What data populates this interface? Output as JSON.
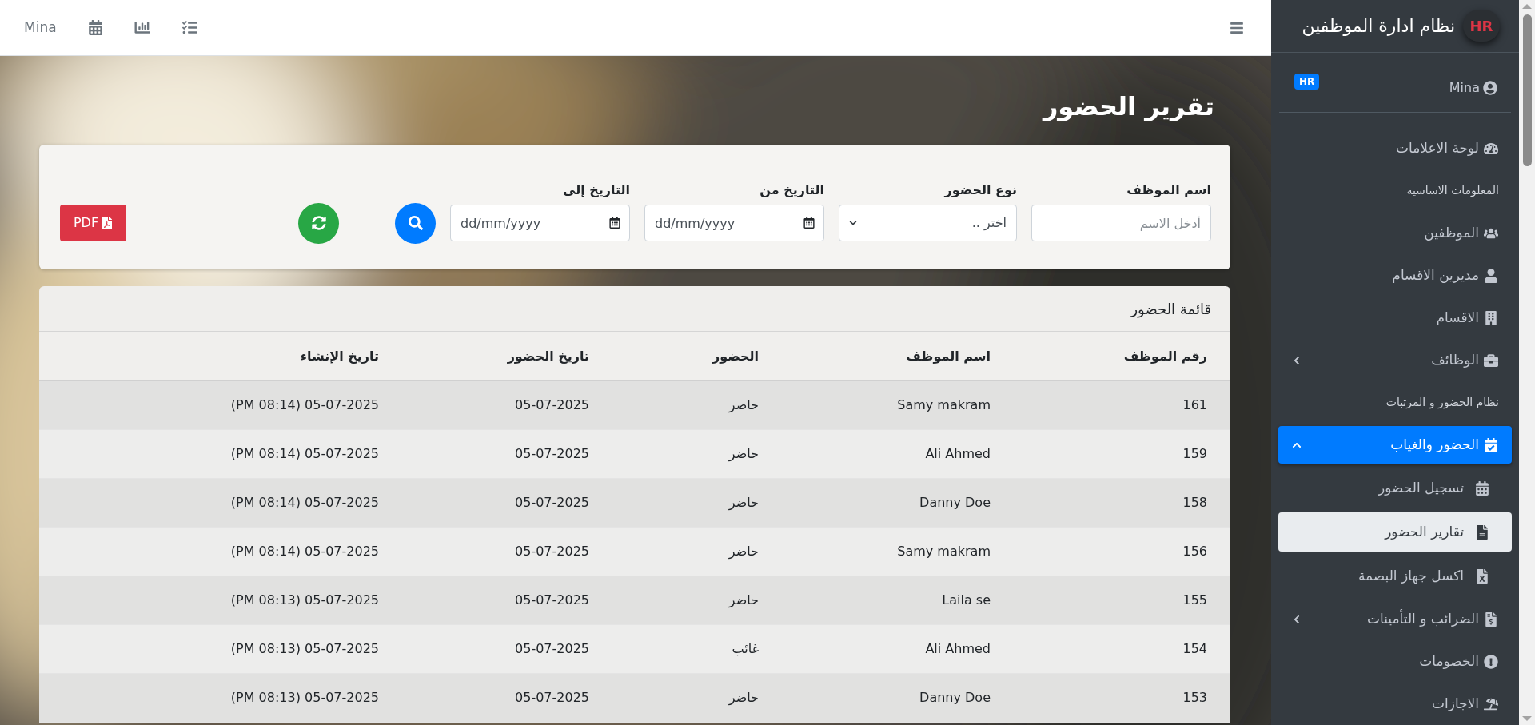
{
  "topbar": {
    "user": "Mina"
  },
  "sidebar": {
    "brand": {
      "logo": "HR",
      "title": "نظام ادارة الموظفين"
    },
    "user": {
      "name": "Mina",
      "badge": "HR"
    },
    "items": [
      {
        "kind": "link",
        "label": "لوحة الاعلامات",
        "selected": false
      },
      {
        "kind": "heading",
        "label": "المعلومات الاساسية"
      },
      {
        "kind": "link",
        "label": "الموظفين",
        "selected": false
      },
      {
        "kind": "link",
        "label": "مديرين الاقسام",
        "selected": false
      },
      {
        "kind": "link",
        "label": "الاقسام",
        "selected": false
      },
      {
        "kind": "link",
        "label": "الوظائف",
        "selected": false,
        "expanded": false
      },
      {
        "kind": "heading",
        "label": "نظام الحضور و المرتبات"
      },
      {
        "kind": "link",
        "label": "الحضور والغياب",
        "selected": true,
        "expanded": true,
        "children": [
          {
            "label": "تسجيل الحضور",
            "selected": false
          },
          {
            "label": "تقارير الحضور",
            "selected": true
          },
          {
            "label": "اكسل جهاز البصمة",
            "selected": false
          }
        ]
      },
      {
        "kind": "link",
        "label": "الضرائب و التأمينات",
        "selected": false,
        "expanded": false
      },
      {
        "kind": "link",
        "label": "الخصومات",
        "selected": false
      },
      {
        "kind": "link",
        "label": "الاجازات",
        "selected": false
      }
    ]
  },
  "page": {
    "title": "تقرير الحضور"
  },
  "filters": {
    "fields": [
      {
        "kind": "text",
        "label": "اسم الموظف",
        "placeholder": "أدخل الاسم"
      },
      {
        "kind": "select",
        "label": "نوع الحضور",
        "value": "اختر .."
      },
      {
        "kind": "date",
        "label": "التاريخ من",
        "placeholder": "dd/mm/yyyy"
      },
      {
        "kind": "date",
        "label": "التاريخ إلى",
        "placeholder": "dd/mm/yyyy"
      }
    ],
    "pdf_button": "PDF"
  },
  "table": {
    "title": "قائمة الحضور",
    "columns": [
      "رقم الموظف",
      "اسم الموظف",
      "الحضور",
      "تاريخ الحضور",
      "تاريخ الإنشاء"
    ],
    "rows": [
      [
        "161",
        "Samy makram",
        "حاضر",
        "05-07-2025",
        "05-07-2025 (PM 08:14)"
      ],
      [
        "159",
        "Ali Ahmed",
        "حاضر",
        "05-07-2025",
        "05-07-2025 (PM 08:14)"
      ],
      [
        "158",
        "Danny Doe",
        "حاضر",
        "05-07-2025",
        "05-07-2025 (PM 08:14)"
      ],
      [
        "156",
        "Samy makram",
        "حاضر",
        "05-07-2025",
        "05-07-2025 (PM 08:14)"
      ],
      [
        "155",
        "Laila se",
        "حاضر",
        "05-07-2025",
        "05-07-2025 (PM 08:13)"
      ],
      [
        "154",
        "Ali Ahmed",
        "غائب",
        "05-07-2025",
        "05-07-2025 (PM 08:13)"
      ],
      [
        "153",
        "Danny Doe",
        "حاضر",
        "05-07-2025",
        "05-07-2025 (PM 08:13)"
      ]
    ]
  }
}
